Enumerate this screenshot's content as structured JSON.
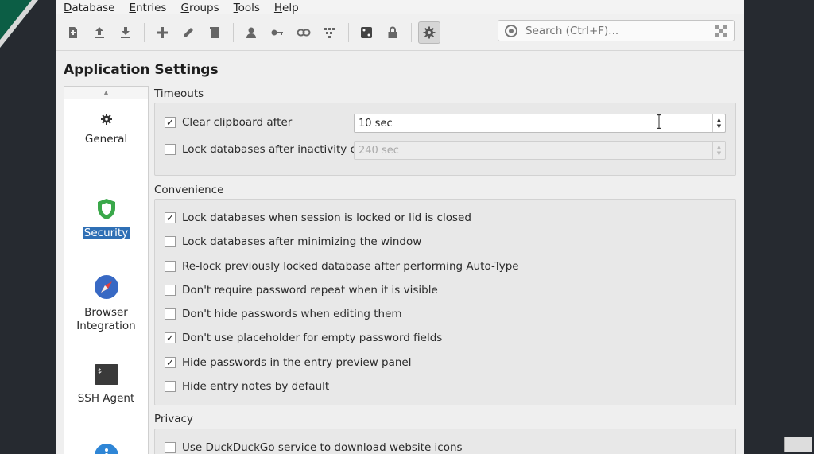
{
  "menu": [
    {
      "underline": "D",
      "rest": "atabase"
    },
    {
      "underline": "E",
      "rest": "ntries"
    },
    {
      "underline": "G",
      "rest": "roups"
    },
    {
      "underline": "T",
      "rest": "ools"
    },
    {
      "underline": "H",
      "rest": "elp"
    }
  ],
  "toolbar": {
    "icons": [
      "new-database-icon",
      "open-database-icon",
      "save-database-icon",
      "add-entry-icon",
      "edit-entry-icon",
      "delete-entry-icon",
      "copy-username-icon",
      "copy-password-icon",
      "copy-url-icon",
      "autotype-icon",
      "password-generator-icon",
      "lock-database-icon",
      "settings-icon"
    ]
  },
  "search": {
    "placeholder": "Search (Ctrl+F)..."
  },
  "page": {
    "title": "Application Settings"
  },
  "categories": {
    "general": "General",
    "security": "Security",
    "browser": "Browser Integration",
    "ssh": "SSH Agent"
  },
  "timeouts": {
    "title": "Timeouts",
    "clear_clipboard": {
      "label": "Clear clipboard after",
      "checked": true,
      "value": "10 sec"
    },
    "lock_inactivity": {
      "label": "Lock databases after inactivity of",
      "checked": false,
      "value": "240 sec"
    }
  },
  "convenience": {
    "title": "Convenience",
    "options": [
      {
        "label": "Lock databases when session is locked or lid is closed",
        "checked": true
      },
      {
        "label": "Lock databases after minimizing the window",
        "checked": false
      },
      {
        "label": "Re-lock previously locked database after performing Auto-Type",
        "checked": false
      },
      {
        "label": "Don't require password repeat when it is visible",
        "checked": false
      },
      {
        "label": "Don't hide passwords when editing them",
        "checked": false
      },
      {
        "label": "Don't use placeholder for empty password fields",
        "checked": true
      },
      {
        "label": "Hide passwords in the entry preview panel",
        "checked": true
      },
      {
        "label": "Hide entry notes by default",
        "checked": false
      }
    ]
  },
  "privacy": {
    "title": "Privacy",
    "options": [
      {
        "label": "Use DuckDuckGo service to download website icons",
        "checked": false
      }
    ]
  },
  "colors": {
    "accent": "#2f6fb5",
    "security_green": "#3aa84a",
    "browser_blue": "#3869c4"
  }
}
